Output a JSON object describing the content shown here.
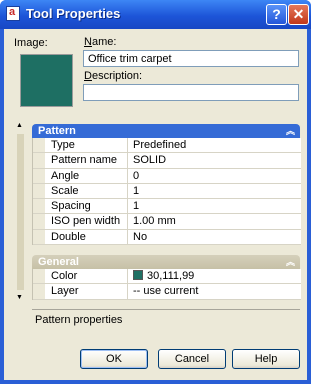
{
  "window": {
    "title": "Tool Properties"
  },
  "titlebar_buttons": {
    "help": "?",
    "close": "✕"
  },
  "image_label": "Image:",
  "image_color": "#1e6f63",
  "name": {
    "label": "Name:",
    "value": "Office trim carpet"
  },
  "description": {
    "label": "Description:",
    "value": ""
  },
  "pattern": {
    "header": "Pattern",
    "rows": [
      {
        "key": "Type",
        "value": "Predefined"
      },
      {
        "key": "Pattern name",
        "value": "SOLID"
      },
      {
        "key": "Angle",
        "value": "0"
      },
      {
        "key": "Scale",
        "value": "1"
      },
      {
        "key": "Spacing",
        "value": "1"
      },
      {
        "key": "ISO pen width",
        "value": "1.00 mm"
      },
      {
        "key": "Double",
        "value": "No"
      }
    ]
  },
  "general": {
    "header": "General",
    "rows": [
      {
        "key": "Color",
        "value": "30,111,99"
      },
      {
        "key": "Layer",
        "value": "-- use current"
      }
    ]
  },
  "help_text": "Pattern properties",
  "buttons": {
    "ok": "OK",
    "cancel": "Cancel",
    "help": "Help"
  },
  "icons": {
    "collapse": "chevron-double-up-icon",
    "scroll_up": "up-arrow-icon",
    "scroll_down": "down-arrow-icon"
  }
}
